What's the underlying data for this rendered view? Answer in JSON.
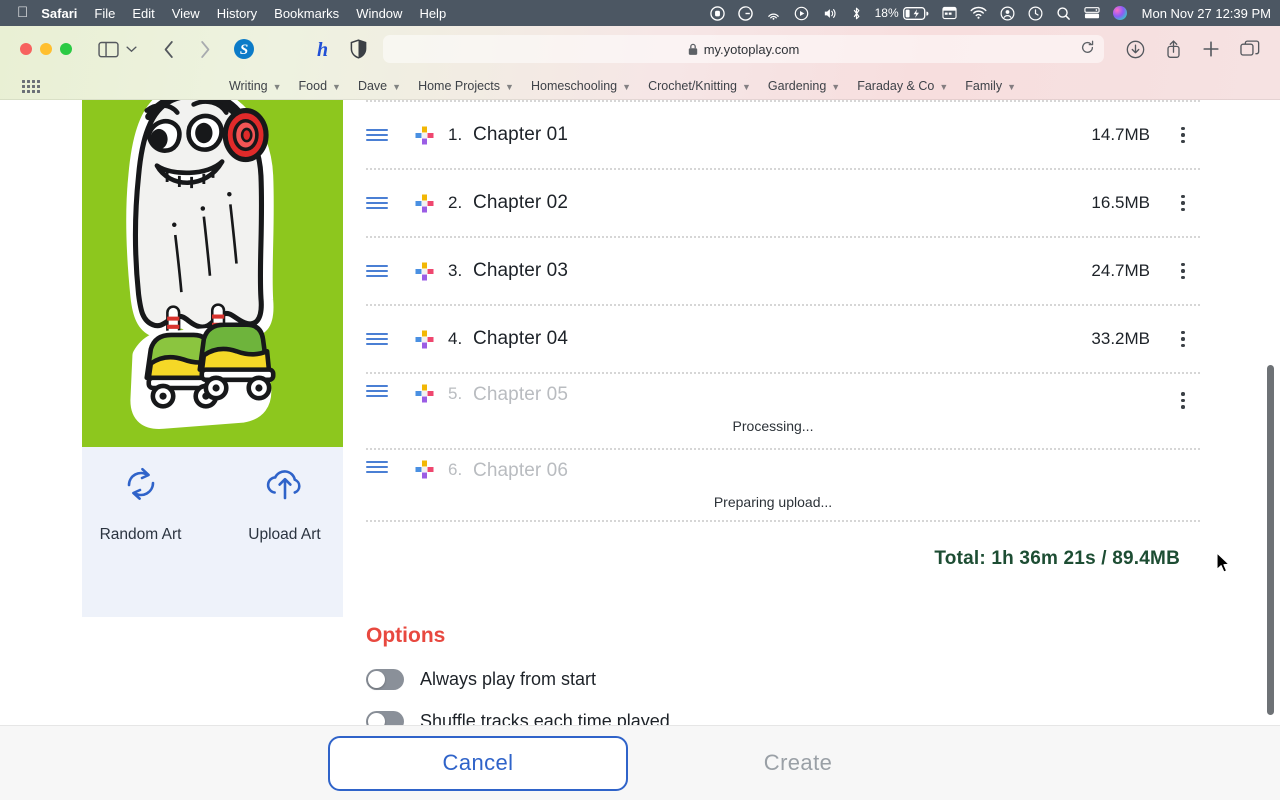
{
  "menubar": {
    "apple_icon": "apple-logo",
    "items": [
      {
        "label": "Safari",
        "bold": true
      },
      {
        "label": "File",
        "bold": false
      },
      {
        "label": "Edit",
        "bold": false
      },
      {
        "label": "View",
        "bold": false
      },
      {
        "label": "History",
        "bold": false
      },
      {
        "label": "Bookmarks",
        "bold": false
      },
      {
        "label": "Window",
        "bold": false
      },
      {
        "label": "Help",
        "bold": false
      }
    ],
    "status_icons": [
      "screen-record-icon",
      "grammarly-icon",
      "airdrop-icon",
      "playback-icon",
      "volume-icon",
      "bluetooth-icon"
    ],
    "battery_percent": "18%",
    "right_icons": [
      "calendar-icon",
      "wifi-icon",
      "control-center-icon",
      "time-machine-icon",
      "search-icon",
      "display-icon",
      "siri-icon"
    ],
    "clock": "Mon Nov 27  12:39 PM",
    "bar_color": "#4c5763"
  },
  "browser": {
    "url": "my.yotoplay.com",
    "lock_icon": "padlock-icon",
    "reload_icon": "reload-icon",
    "sidebar_icon": "sidebar-toggle-icon",
    "back_icon": "back-chevron-icon",
    "forward_icon": "forward-chevron-icon",
    "extensions": [
      "skype-icon",
      "honey-icon",
      "reader-shield-icon"
    ],
    "right_buttons": [
      "downloads-icon",
      "share-icon",
      "new-tab-icon",
      "tab-overview-icon"
    ],
    "favorites_grid_icon": "apps-grid-icon",
    "favorites": [
      {
        "label": "Writing"
      },
      {
        "label": "Food"
      },
      {
        "label": "Dave"
      },
      {
        "label": "Home Projects"
      },
      {
        "label": "Homeschooling"
      },
      {
        "label": "Crochet/Knitting"
      },
      {
        "label": "Gardening"
      },
      {
        "label": "Faraday & Co"
      },
      {
        "label": "Family"
      }
    ]
  },
  "artwork": {
    "background_color": "#8dc71e",
    "alt": "cartoon ghost with headphones on roller skates",
    "actions": [
      {
        "label": "Random Art",
        "icon": "refresh-circular-arrows-icon"
      },
      {
        "label": "Upload Art",
        "icon": "cloud-upload-icon"
      }
    ]
  },
  "tracks": {
    "rows": [
      {
        "num": "1.",
        "name": "Chapter 01",
        "size": "14.7MB",
        "status": "",
        "pending": false,
        "has_menu": true
      },
      {
        "num": "2.",
        "name": "Chapter 02",
        "size": "16.5MB",
        "status": "",
        "pending": false,
        "has_menu": true
      },
      {
        "num": "3.",
        "name": "Chapter 03",
        "size": "24.7MB",
        "status": "",
        "pending": false,
        "has_menu": true
      },
      {
        "num": "4.",
        "name": "Chapter 04",
        "size": "33.2MB",
        "status": "",
        "pending": false,
        "has_menu": true
      },
      {
        "num": "5.",
        "name": "Chapter 05",
        "size": "",
        "status": "Processing...",
        "pending": true,
        "has_menu": true
      },
      {
        "num": "6.",
        "name": "Chapter 06",
        "size": "",
        "status": "Preparing upload...",
        "pending": true,
        "has_menu": false
      }
    ],
    "total": "Total: 1h 36m 21s / 89.4MB",
    "total_color": "#1d4d33",
    "drag_handle_icon": "drag-handle-icon",
    "source_icon": "four-color-cross-icon",
    "menu_icon": "kebab-menu-icon"
  },
  "options": {
    "title": "Options",
    "title_color": "#e8483f",
    "toggles": [
      {
        "label": "Always play from start",
        "on": false
      },
      {
        "label": "Shuffle tracks each time played",
        "on": false
      }
    ]
  },
  "footer": {
    "cancel_label": "Cancel",
    "create_label": "Create",
    "cancel_color": "#2f63c9",
    "create_color": "#9aa0a6"
  }
}
